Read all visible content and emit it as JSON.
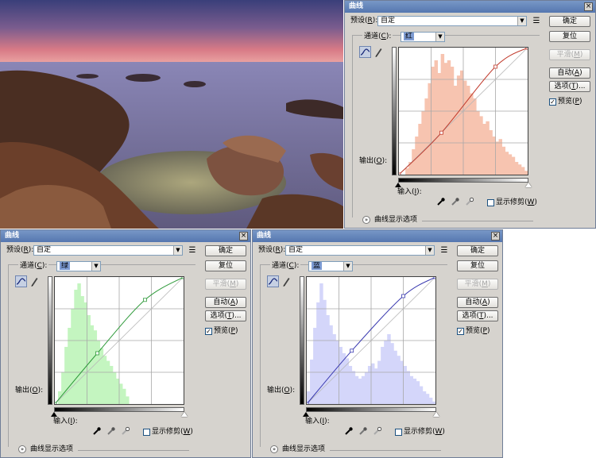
{
  "dialogs": [
    {
      "id": "red",
      "title": "曲线",
      "preset_label": "预设(R):",
      "preset_value": "自定",
      "channel_label": "通道(C):",
      "channel_value": "红",
      "buttons": {
        "ok": "确定",
        "reset": "复位",
        "smooth": "平滑(M)",
        "auto": "自动(A)",
        "options": "选项(T)..."
      },
      "preview_label": "预览(P)",
      "output_label": "输出(O):",
      "input_label": "输入(I):",
      "show_clipping_label": "显示修剪(W)",
      "curve_display_label": "曲线显示选项",
      "colors": {
        "histogram": "#f7c4b0",
        "curve": "#c0392b"
      },
      "histogram": [
        0,
        0,
        0.05,
        0.1,
        0.2,
        0.3,
        0.4,
        0.5,
        0.6,
        0.72,
        0.85,
        0.9,
        0.8,
        0.95,
        0.88,
        0.9,
        0.85,
        0.7,
        0.78,
        0.82,
        0.74,
        0.7,
        0.64,
        0.6,
        0.5,
        0.46,
        0.4,
        0.42,
        0.35,
        0.3,
        0.26,
        0.28,
        0.22,
        0.18,
        0.16,
        0.14,
        0.1,
        0.08,
        0.06,
        0.03
      ],
      "curve_points": [
        [
          0,
          0
        ],
        [
          0.33,
          0.33
        ],
        [
          0.75,
          0.85
        ],
        [
          1,
          1
        ]
      ]
    },
    {
      "id": "green",
      "title": "曲线",
      "preset_label": "预设(R):",
      "preset_value": "自定",
      "channel_label": "通道(C):",
      "channel_value": "绿",
      "buttons": {
        "ok": "确定",
        "reset": "复位",
        "smooth": "平滑(M)",
        "auto": "自动(A)",
        "options": "选项(T)..."
      },
      "preview_label": "预览(P)",
      "output_label": "输出(O):",
      "input_label": "输入(I):",
      "show_clipping_label": "显示修剪(W)",
      "curve_display_label": "曲线显示选项",
      "colors": {
        "histogram": "#c4f5c0",
        "curve": "#2e9a3a"
      },
      "histogram": [
        0,
        0.1,
        0.25,
        0.45,
        0.6,
        0.75,
        0.9,
        0.95,
        0.85,
        0.8,
        0.7,
        0.62,
        0.58,
        0.5,
        0.44,
        0.38,
        0.34,
        0.3,
        0.25,
        0.2,
        0.16,
        0.12,
        0.06,
        0,
        0,
        0,
        0,
        0,
        0,
        0,
        0,
        0,
        0,
        0,
        0,
        0,
        0,
        0,
        0,
        0
      ],
      "curve_points": [
        [
          0,
          0
        ],
        [
          0.33,
          0.4
        ],
        [
          0.7,
          0.82
        ],
        [
          1,
          1
        ]
      ]
    },
    {
      "id": "blue",
      "title": "曲线",
      "preset_label": "预设(R):",
      "preset_value": "自定",
      "channel_label": "通道(C):",
      "channel_value": "蓝",
      "buttons": {
        "ok": "确定",
        "reset": "复位",
        "smooth": "平滑(M)",
        "auto": "自动(A)",
        "options": "选项(T)..."
      },
      "preview_label": "预览(P)",
      "output_label": "输出(O):",
      "input_label": "输入(I):",
      "show_clipping_label": "显示修剪(W)",
      "curve_display_label": "曲线显示选项",
      "colors": {
        "histogram": "#d4d6fa",
        "curve": "#3a3ab0"
      },
      "histogram": [
        0.1,
        0.35,
        0.6,
        0.8,
        0.95,
        0.82,
        0.7,
        0.62,
        0.55,
        0.5,
        0.45,
        0.4,
        0.36,
        0.3,
        0.26,
        0.22,
        0.2,
        0.22,
        0.25,
        0.3,
        0.32,
        0.28,
        0.34,
        0.45,
        0.5,
        0.55,
        0.48,
        0.42,
        0.38,
        0.34,
        0.3,
        0.26,
        0.22,
        0.2,
        0.18,
        0.14,
        0.1,
        0.08,
        0.05,
        0.02
      ],
      "curve_points": [
        [
          0,
          0
        ],
        [
          0.35,
          0.42
        ],
        [
          0.75,
          0.85
        ],
        [
          1,
          1
        ]
      ]
    }
  ]
}
